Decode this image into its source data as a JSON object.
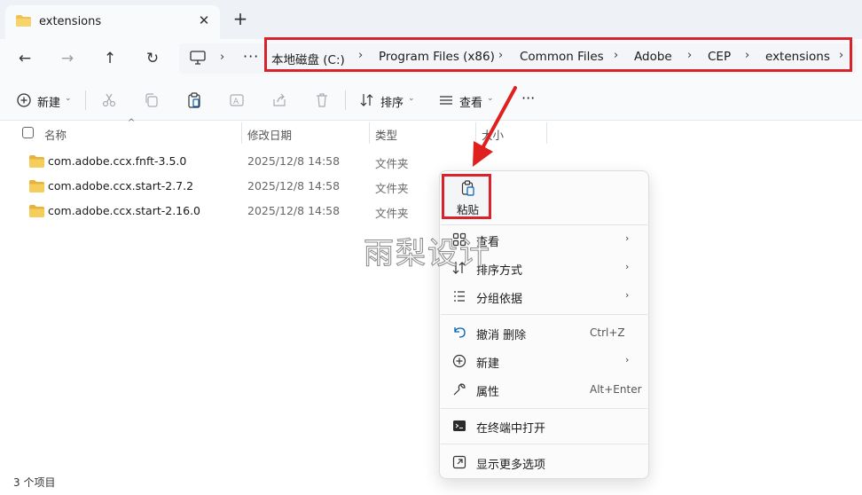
{
  "tab": {
    "title": "extensions",
    "close": "✕",
    "new_tab": "+"
  },
  "nav": {
    "back": "←",
    "forward": "→",
    "up": "↑",
    "refresh": "↻",
    "more": "···",
    "chevron": "›"
  },
  "breadcrumb": {
    "items": [
      "本地磁盘 (C:)",
      "Program Files (x86)",
      "Common Files",
      "Adobe",
      "CEP",
      "extensions"
    ],
    "separator": "›"
  },
  "toolbar": {
    "new_label": "新建",
    "sort_label": "排序",
    "view_label": "查看",
    "more": "···",
    "caret": "⌄"
  },
  "columns": {
    "name": "名称",
    "date": "修改日期",
    "type": "类型",
    "size": "大小",
    "sort_caret": "^"
  },
  "files": [
    {
      "name": "com.adobe.ccx.fnft-3.5.0",
      "date": "2025/12/8 14:58",
      "type": "文件夹"
    },
    {
      "name": "com.adobe.ccx.start-2.7.2",
      "date": "2025/12/8 14:58",
      "type": "文件夹"
    },
    {
      "name": "com.adobe.ccx.start-2.16.0",
      "date": "2025/12/8 14:58",
      "type": "文件夹"
    }
  ],
  "status": {
    "count": "3 个项目"
  },
  "watermark": "雨梨设计",
  "context_menu": {
    "paste_label": "粘贴",
    "chevron": "›",
    "items": [
      {
        "label": "查看"
      },
      {
        "label": "排序方式"
      },
      {
        "label": "分组依据"
      },
      {
        "label": "撤消 删除",
        "shortcut": "Ctrl+Z"
      },
      {
        "label": "新建"
      },
      {
        "label": "属性",
        "shortcut": "Alt+Enter"
      },
      {
        "label": "在终端中打开"
      },
      {
        "label": "显示更多选项"
      }
    ]
  },
  "colors": {
    "folder": "#f2c14e",
    "highlight_border": "#d8232a",
    "accent": "#005fb8"
  }
}
